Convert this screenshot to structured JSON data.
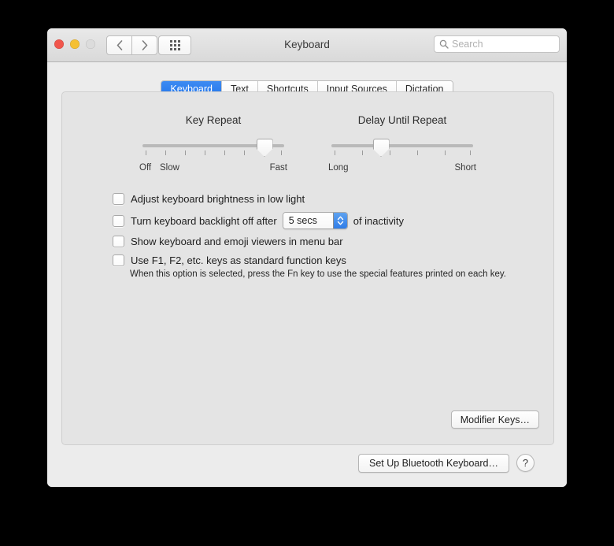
{
  "window": {
    "title": "Keyboard",
    "traffic_lights": [
      "close",
      "minimize",
      "zoom"
    ],
    "nav": {
      "back_icon": "chevron-left-icon",
      "forward_icon": "chevron-right-icon",
      "grid_icon": "show-all-grid-icon"
    },
    "search": {
      "placeholder": "Search",
      "value": "",
      "icon": "search-icon"
    }
  },
  "tabs": [
    {
      "label": "Keyboard",
      "active": true
    },
    {
      "label": "Text",
      "active": false
    },
    {
      "label": "Shortcuts",
      "active": false
    },
    {
      "label": "Input Sources",
      "active": false
    },
    {
      "label": "Dictation",
      "active": false
    }
  ],
  "sliders": {
    "key_repeat": {
      "title": "Key Repeat",
      "left_label": "Off",
      "second_label": "Slow",
      "right_label": "Fast",
      "ticks": 8,
      "value_index": 6
    },
    "delay_until_repeat": {
      "title": "Delay Until Repeat",
      "left_label": "Long",
      "right_label": "Short",
      "ticks": 6,
      "value_index": 2
    }
  },
  "checkboxes": [
    {
      "label": "Adjust keyboard brightness in low light",
      "checked": false
    },
    {
      "label": "Turn keyboard backlight off after",
      "checked": false,
      "suffix": "of inactivity"
    },
    {
      "label": "Show keyboard and emoji viewers in menu bar",
      "checked": false
    },
    {
      "label": "Use F1, F2, etc. keys as standard function keys",
      "checked": false
    }
  ],
  "backlight_popup": {
    "value": "5 secs",
    "icon": "stepper-up-down-icon"
  },
  "help_text": "When this option is selected, press the Fn key to use the special features printed on each key.",
  "buttons": {
    "modifier_keys": "Modifier Keys…",
    "setup_bluetooth": "Set Up Bluetooth Keyboard…",
    "help": "?"
  },
  "colors": {
    "accent": "#2277ec",
    "panel": "#e4e4e4",
    "window": "#ececec"
  }
}
